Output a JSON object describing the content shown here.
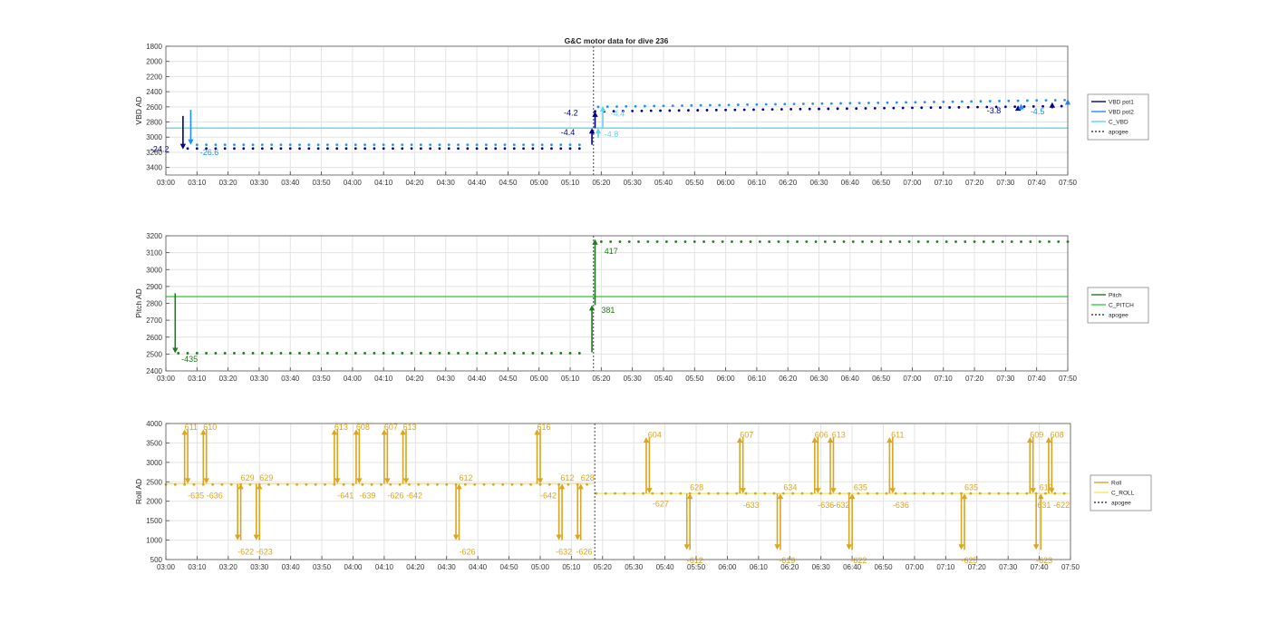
{
  "figure_title": "G&C motor data for dive 236",
  "x_ticks": [
    "03:00",
    "03:10",
    "03:20",
    "03:30",
    "03:40",
    "03:50",
    "04:00",
    "04:10",
    "04:20",
    "04:30",
    "04:40",
    "04:50",
    "05:00",
    "05:10",
    "05:20",
    "05:30",
    "05:40",
    "05:50",
    "06:00",
    "06:10",
    "06:20",
    "06:30",
    "06:40",
    "06:50",
    "07:00",
    "07:10",
    "07:20",
    "07:30",
    "07:40",
    "07:50"
  ],
  "colors": {
    "vbd_pot1": "#00008b",
    "vbd_pot2": "#1e90ff",
    "c_vbd": "#5fd3f0",
    "pitch": "#1e7b1e",
    "c_pitch": "#3cd03c",
    "roll": "#daa520",
    "c_roll": "#f5e663",
    "apogee": "#444444",
    "grid": "#e3e3e3"
  },
  "chart_data": [
    {
      "type": "line",
      "ylabel": "VBD AD",
      "ylim": [
        1800,
        3500
      ],
      "y_reversed": true,
      "yticks": [
        1800,
        2000,
        2200,
        2400,
        2600,
        2800,
        3000,
        3200,
        3400
      ],
      "grid": true,
      "legend_position": "right",
      "legend": [
        {
          "name": "VBD pot1",
          "color": "vbd_pot1",
          "style": "solid"
        },
        {
          "name": "VBD pot2",
          "color": "vbd_pot2",
          "style": "solid"
        },
        {
          "name": "C_VBD",
          "color": "c_vbd",
          "style": "solid"
        },
        {
          "name": "apogee",
          "color": "apogee",
          "style": "dashed"
        }
      ],
      "apogee_min": 137.5,
      "reference": {
        "name": "C_VBD",
        "color": "c_vbd",
        "y": 2880
      },
      "series": [
        {
          "name": "VBD pot1",
          "color": "vbd_pot1",
          "segments": [
            {
              "x_start": 7,
              "x_end": 133,
              "y": 3150
            },
            {
              "x_start": 138,
              "x_end": 290,
              "y": 2660,
              "y_end": 2590
            }
          ]
        },
        {
          "name": "VBD pot2",
          "color": "vbd_pot2",
          "segments": [
            {
              "x_start": 10,
              "x_end": 133,
              "y": 3100
            },
            {
              "x_start": 139,
              "x_end": 290,
              "y": 2600,
              "y_end": 2510
            }
          ]
        }
      ],
      "arrows": [
        {
          "x": 5.5,
          "from": 2720,
          "to": 3160,
          "color": "vbd_pot1",
          "label": "-24.2",
          "lx": -5,
          "ly": 3160
        },
        {
          "x": 8,
          "from": 2640,
          "to": 3100,
          "color": "vbd_pot2",
          "label": "-26.6",
          "lx": 11,
          "ly": 3200
        },
        {
          "x": 137,
          "from": 3100,
          "to": 2880,
          "color": "vbd_pot1",
          "label": "-4.4",
          "lx": 127,
          "ly": 2940
        },
        {
          "x": 138,
          "from": 2880,
          "to": 2660,
          "color": "vbd_pot1",
          "label": "-4.2",
          "lx": 128,
          "ly": 2680
        },
        {
          "x": 139,
          "from": 3010,
          "to": 2880,
          "color": "c_vbd",
          "label": "-4.8",
          "lx": 141,
          "ly": 2960
        },
        {
          "x": 140.5,
          "from": 2880,
          "to": 2590,
          "color": "c_vbd",
          "label": "-4.4",
          "lx": 143,
          "ly": 2690
        },
        {
          "x": 274,
          "from": 2640,
          "to": 2580,
          "color": "vbd_pot1",
          "label": "-3.8",
          "lx": 264,
          "ly": 2650
        },
        {
          "x": 275,
          "from": 2640,
          "to": 2560,
          "color": "vbd_pot2",
          "label": "-4.5",
          "lx": 278,
          "ly": 2660
        },
        {
          "x": 285,
          "from": 2620,
          "to": 2540,
          "color": "vbd_pot1",
          "label": "",
          "lx": 0,
          "ly": 0
        },
        {
          "x": 290,
          "from": 2560,
          "to": 2500,
          "color": "vbd_pot2",
          "label": "",
          "lx": 0,
          "ly": 0
        }
      ]
    },
    {
      "type": "line",
      "ylabel": "Pitch AD",
      "ylim": [
        2400,
        3200
      ],
      "y_reversed": false,
      "yticks": [
        2400,
        2500,
        2600,
        2700,
        2800,
        2900,
        3000,
        3100,
        3200
      ],
      "grid": true,
      "legend_position": "right",
      "legend": [
        {
          "name": "Pitch",
          "color": "pitch",
          "style": "solid"
        },
        {
          "name": "C_PITCH",
          "color": "c_pitch",
          "style": "solid"
        },
        {
          "name": "apogee",
          "color": "apogee",
          "style": "dashed"
        }
      ],
      "apogee_min": 137.5,
      "reference": {
        "name": "C_PITCH",
        "color": "c_pitch",
        "y": 2840
      },
      "series": [
        {
          "name": "Pitch",
          "color": "pitch",
          "segments": [
            {
              "x_start": 4,
              "x_end": 133,
              "y": 2505
            },
            {
              "x_start": 140,
              "x_end": 290,
              "y": 3165
            }
          ]
        }
      ],
      "arrows": [
        {
          "x": 3,
          "from": 2860,
          "to": 2505,
          "color": "pitch",
          "label": "-435",
          "lx": 5,
          "ly": 2470
        },
        {
          "x": 137,
          "from": 2510,
          "to": 2790,
          "color": "pitch",
          "label": "381",
          "lx": 140,
          "ly": 2760
        },
        {
          "x": 138,
          "from": 2790,
          "to": 3180,
          "color": "pitch",
          "label": "417",
          "lx": 141,
          "ly": 3110
        }
      ]
    },
    {
      "type": "line",
      "ylabel": "Roll AD",
      "ylim": [
        500,
        4000
      ],
      "y_reversed": false,
      "yticks": [
        500,
        1000,
        1500,
        2000,
        2500,
        3000,
        3500,
        4000
      ],
      "grid": true,
      "legend_position": "right",
      "legend": [
        {
          "name": "Roll",
          "color": "roll",
          "style": "solid"
        },
        {
          "name": "C_ROLL",
          "color": "c_roll",
          "style": "solid"
        },
        {
          "name": "apogee",
          "color": "apogee",
          "style": "dashed"
        }
      ],
      "apogee_min": 137.5,
      "references": [
        {
          "name": "C_ROLL",
          "color": "c_roll",
          "x_start": 0,
          "x_end": 137.5,
          "y": 2450
        },
        {
          "name": "C_ROLL",
          "color": "c_roll",
          "x_start": 137.5,
          "x_end": 290,
          "y": 2200
        }
      ],
      "series": [
        {
          "name": "Roll",
          "color": "roll",
          "segments": [
            {
              "x_start": 0,
              "x_end": 136,
              "y": 2430
            },
            {
              "x_start": 138,
              "x_end": 290,
              "y": 2200
            }
          ]
        }
      ],
      "arrows": [
        {
          "x": 6,
          "from": 2450,
          "to": 3850,
          "color": "roll",
          "label": "611",
          "lx": 6,
          "ly": 3910
        },
        {
          "x": 7,
          "from": 3850,
          "to": 2450,
          "color": "roll",
          "label": "-635",
          "lx": 7,
          "ly": 2150
        },
        {
          "x": 12,
          "from": 2450,
          "to": 3850,
          "color": "roll",
          "label": "610",
          "lx": 12,
          "ly": 3910
        },
        {
          "x": 13,
          "from": 3850,
          "to": 2450,
          "color": "roll",
          "label": "-636",
          "lx": 13,
          "ly": 2150
        },
        {
          "x": 23,
          "from": 2450,
          "to": 1000,
          "color": "roll",
          "label": "-622",
          "lx": 23,
          "ly": 700
        },
        {
          "x": 24,
          "from": 1000,
          "to": 2450,
          "color": "roll",
          "label": "629",
          "lx": 24,
          "ly": 2600
        },
        {
          "x": 29,
          "from": 2450,
          "to": 1000,
          "color": "roll",
          "label": "-623",
          "lx": 29,
          "ly": 700
        },
        {
          "x": 30,
          "from": 1000,
          "to": 2450,
          "color": "roll",
          "label": "629",
          "lx": 30,
          "ly": 2600
        },
        {
          "x": 54,
          "from": 2450,
          "to": 3850,
          "color": "roll",
          "label": "613",
          "lx": 54,
          "ly": 3910
        },
        {
          "x": 55,
          "from": 3850,
          "to": 2450,
          "color": "roll",
          "label": "-641",
          "lx": 55,
          "ly": 2150
        },
        {
          "x": 61,
          "from": 2450,
          "to": 3850,
          "color": "roll",
          "label": "608",
          "lx": 61,
          "ly": 3910
        },
        {
          "x": 62,
          "from": 3850,
          "to": 2450,
          "color": "roll",
          "label": "-639",
          "lx": 62,
          "ly": 2150
        },
        {
          "x": 70,
          "from": 2450,
          "to": 3850,
          "color": "roll",
          "label": "607",
          "lx": 70,
          "ly": 3910
        },
        {
          "x": 71,
          "from": 3850,
          "to": 2450,
          "color": "roll",
          "label": "-626",
          "lx": 71,
          "ly": 2150
        },
        {
          "x": 76,
          "from": 2450,
          "to": 3850,
          "color": "roll",
          "label": "613",
          "lx": 76,
          "ly": 3910
        },
        {
          "x": 77,
          "from": 3850,
          "to": 2450,
          "color": "roll",
          "label": "-642",
          "lx": 77,
          "ly": 2150
        },
        {
          "x": 93,
          "from": 2450,
          "to": 1000,
          "color": "roll",
          "label": "-626",
          "lx": 94,
          "ly": 700
        },
        {
          "x": 94,
          "from": 1000,
          "to": 2450,
          "color": "roll",
          "label": "612",
          "lx": 94,
          "ly": 2600
        },
        {
          "x": 119,
          "from": 2450,
          "to": 3850,
          "color": "roll",
          "label": "616",
          "lx": 119,
          "ly": 3910
        },
        {
          "x": 120,
          "from": 3850,
          "to": 2450,
          "color": "roll",
          "label": "-642",
          "lx": 120,
          "ly": 2150
        },
        {
          "x": 126,
          "from": 2450,
          "to": 1000,
          "color": "roll",
          "label": "-632",
          "lx": 125,
          "ly": 700
        },
        {
          "x": 127,
          "from": 1000,
          "to": 2450,
          "color": "roll",
          "label": "612",
          "lx": 126.5,
          "ly": 2600
        },
        {
          "x": 132,
          "from": 2450,
          "to": 1000,
          "color": "roll",
          "label": "-626",
          "lx": 131.5,
          "ly": 700
        },
        {
          "x": 133,
          "from": 1000,
          "to": 2450,
          "color": "roll",
          "label": "628",
          "lx": 133,
          "ly": 2600
        },
        {
          "x": 154,
          "from": 2200,
          "to": 3650,
          "color": "roll",
          "label": "604",
          "lx": 154.5,
          "ly": 3710
        },
        {
          "x": 155,
          "from": 3650,
          "to": 2200,
          "color": "roll",
          "label": "-627",
          "lx": 156,
          "ly": 1940
        },
        {
          "x": 167,
          "from": 2200,
          "to": 750,
          "color": "roll",
          "label": "-612",
          "lx": 167,
          "ly": 480
        },
        {
          "x": 168,
          "from": 750,
          "to": 2200,
          "color": "roll",
          "label": "628",
          "lx": 168,
          "ly": 2360
        },
        {
          "x": 184,
          "from": 2200,
          "to": 3650,
          "color": "roll",
          "label": "607",
          "lx": 184,
          "ly": 3710
        },
        {
          "x": 185,
          "from": 3650,
          "to": 2200,
          "color": "roll",
          "label": "-633",
          "lx": 185,
          "ly": 1900
        },
        {
          "x": 196,
          "from": 2200,
          "to": 750,
          "color": "roll",
          "label": "-619",
          "lx": 196.5,
          "ly": 480
        },
        {
          "x": 197,
          "from": 750,
          "to": 2200,
          "color": "roll",
          "label": "634",
          "lx": 198,
          "ly": 2360
        },
        {
          "x": 208,
          "from": 2200,
          "to": 3650,
          "color": "roll",
          "label": "606",
          "lx": 208,
          "ly": 3710
        },
        {
          "x": 209,
          "from": 3650,
          "to": 2200,
          "color": "roll",
          "label": "-636",
          "lx": 209,
          "ly": 1900
        },
        {
          "x": 213,
          "from": 2200,
          "to": 3650,
          "color": "roll",
          "label": "613",
          "lx": 213.5,
          "ly": 3710
        },
        {
          "x": 214,
          "from": 3650,
          "to": 2200,
          "color": "roll",
          "label": "-632",
          "lx": 214,
          "ly": 1900
        },
        {
          "x": 219,
          "from": 2200,
          "to": 750,
          "color": "roll",
          "label": "-622",
          "lx": 219.5,
          "ly": 480
        },
        {
          "x": 220,
          "from": 750,
          "to": 2200,
          "color": "roll",
          "label": "635",
          "lx": 220.5,
          "ly": 2360
        },
        {
          "x": 232,
          "from": 2200,
          "to": 3650,
          "color": "roll",
          "label": "611",
          "lx": 232.5,
          "ly": 3710
        },
        {
          "x": 233,
          "from": 3650,
          "to": 2200,
          "color": "roll",
          "label": "-636",
          "lx": 233,
          "ly": 1900
        },
        {
          "x": 255,
          "from": 2200,
          "to": 750,
          "color": "roll",
          "label": "-625",
          "lx": 255,
          "ly": 480
        },
        {
          "x": 256,
          "from": 750,
          "to": 2200,
          "color": "roll",
          "label": "635",
          "lx": 256,
          "ly": 2360
        },
        {
          "x": 277,
          "from": 2200,
          "to": 3650,
          "color": "roll",
          "label": "609",
          "lx": 277,
          "ly": 3710
        },
        {
          "x": 278,
          "from": 3650,
          "to": 2200,
          "color": "roll",
          "label": "-631",
          "lx": 278.5,
          "ly": 1900
        },
        {
          "x": 279,
          "from": 2200,
          "to": 750,
          "color": "roll",
          "label": "-623",
          "lx": 279,
          "ly": 480
        },
        {
          "x": 280.5,
          "from": 750,
          "to": 2200,
          "color": "roll",
          "label": "619",
          "lx": 280,
          "ly": 2360
        },
        {
          "x": 283,
          "from": 2200,
          "to": 3650,
          "color": "roll",
          "label": "608",
          "lx": 283.5,
          "ly": 3710
        },
        {
          "x": 284,
          "from": 3650,
          "to": 2200,
          "color": "roll",
          "label": "-622",
          "lx": 284.5,
          "ly": 1900
        }
      ]
    }
  ]
}
